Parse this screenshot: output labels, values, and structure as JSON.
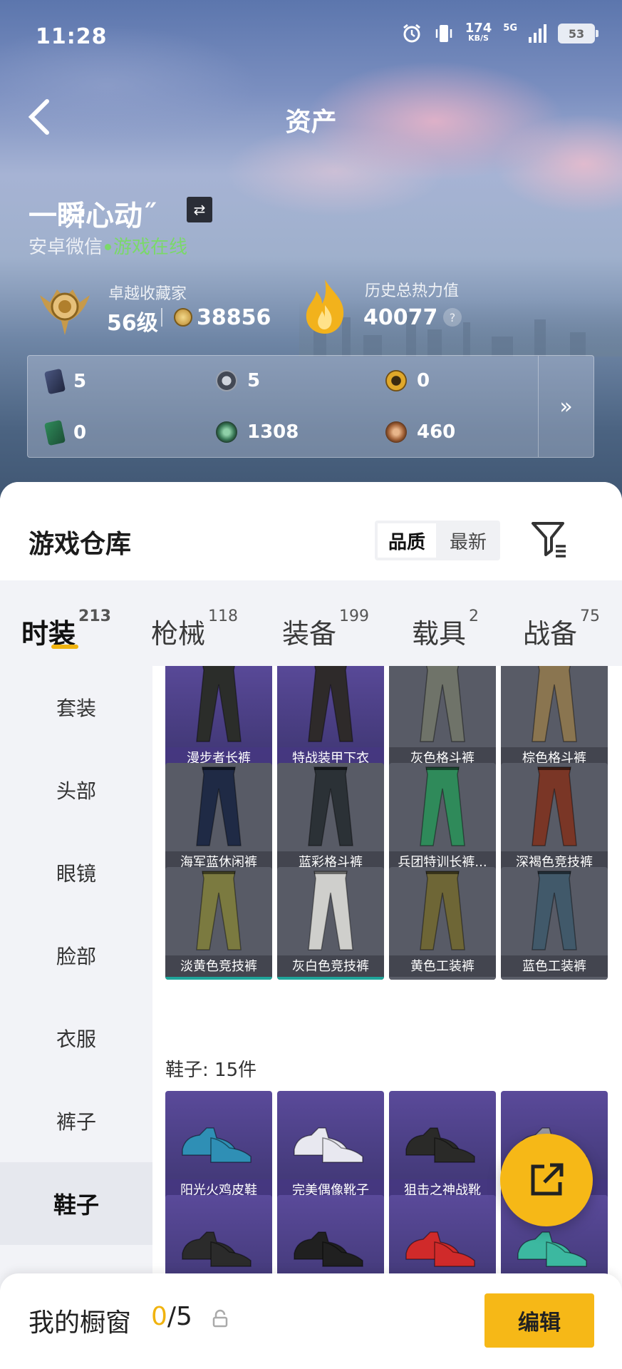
{
  "status": {
    "time": "11:28",
    "speed": "174",
    "speed_unit": "KB/S",
    "network": "5G",
    "battery": "53"
  },
  "header": {
    "title": "资产"
  },
  "profile": {
    "name": "一瞬心动˝",
    "platform": "安卓微信",
    "online": "游戏在线",
    "collector_title": "卓越收藏家",
    "collector_level": "56级",
    "collector_points": "38856",
    "heat_title": "历史总热力值",
    "heat_value": "40077",
    "help": "?"
  },
  "stats": [
    {
      "icon": "card-icon",
      "value": "5"
    },
    {
      "icon": "silver-coin-icon",
      "value": "5"
    },
    {
      "icon": "gold-badge-icon",
      "value": "0"
    },
    {
      "icon": "green-ticket-icon",
      "value": "0"
    },
    {
      "icon": "jade-coin-icon",
      "value": "1308"
    },
    {
      "icon": "bronze-coin-icon",
      "value": "460"
    }
  ],
  "warehouse": {
    "title": "游戏仓库",
    "sort_quality": "品质",
    "sort_latest": "最新"
  },
  "tabs": [
    {
      "label": "时装",
      "count": "213"
    },
    {
      "label": "枪械",
      "count": "118"
    },
    {
      "label": "装备",
      "count": "199"
    },
    {
      "label": "载具",
      "count": "2"
    },
    {
      "label": "战备",
      "count": "75"
    }
  ],
  "sidebar": [
    "套装",
    "头部",
    "眼镜",
    "脸部",
    "衣服",
    "裤子",
    "鞋子"
  ],
  "pants": [
    {
      "name": "漫步者长裤",
      "color": "#2b2d2a",
      "quality": "purple"
    },
    {
      "name": "特战装甲下衣",
      "color": "#2e2a2a",
      "quality": "purple"
    },
    {
      "name": "灰色格斗裤",
      "color": "#6f7369",
      "quality": "grey"
    },
    {
      "name": "棕色格斗裤",
      "color": "#8a7550",
      "quality": "grey"
    },
    {
      "name": "海军蓝休闲裤",
      "color": "#1f2a45",
      "quality": "blue"
    },
    {
      "name": "蓝彩格斗裤",
      "color": "#2b3136",
      "quality": "blue"
    },
    {
      "name": "兵团特训长裤...",
      "color": "#2f8a5a",
      "quality": "grey"
    },
    {
      "name": "深褐色竞技裤",
      "color": "#7a3626",
      "quality": "teal"
    },
    {
      "name": "淡黄色竞技裤",
      "color": "#7b7a40",
      "quality": "teal"
    },
    {
      "name": "灰白色竞技裤",
      "color": "#cfcfcc",
      "quality": "teal"
    },
    {
      "name": "黄色工装裤",
      "color": "#6e6636",
      "quality": "grey"
    },
    {
      "name": "蓝色工装裤",
      "color": "#41596a",
      "quality": "grey"
    }
  ],
  "shoes_section": "鞋子: 15件",
  "shoes": [
    {
      "name": "阳光火鸡皮鞋",
      "color": "#2f8fb5"
    },
    {
      "name": "完美偶像靴子",
      "color": "#e8e8f0"
    },
    {
      "name": "狙击之神战靴",
      "color": "#2a2a28"
    },
    {
      "name": "",
      "color": "#9a9aa2"
    }
  ],
  "shoes_row2": [
    {
      "color": "#2b2b2b"
    },
    {
      "color": "#202020"
    },
    {
      "color": "#d02a2a"
    },
    {
      "color": "#3cb8a0"
    }
  ],
  "showcase": {
    "label": "我的橱窗",
    "count_used": "0",
    "count_total": "/5",
    "edit": "编辑"
  }
}
